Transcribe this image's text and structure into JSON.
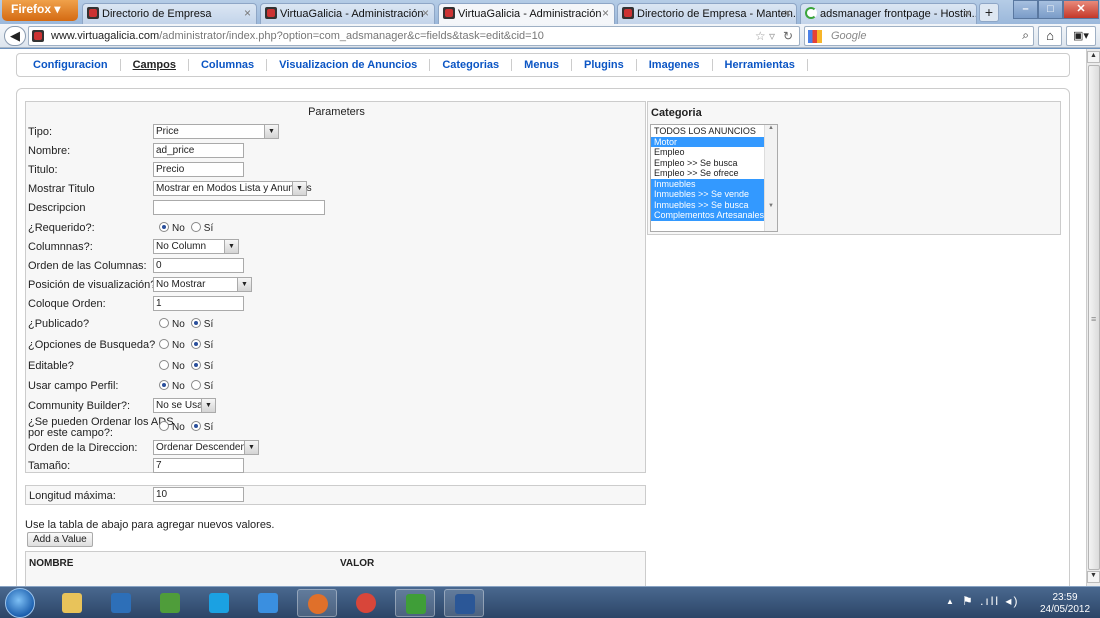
{
  "browser": {
    "app_button": "Firefox",
    "tabs": [
      {
        "title": "Directorio de Empresa"
      },
      {
        "title": "VirtuaGalicia - Administración"
      },
      {
        "title": "VirtuaGalicia - Administración"
      },
      {
        "title": "Directorio de Empresa - Manten..."
      },
      {
        "title": "adsmanager frontpage - Hostin..."
      }
    ],
    "url_domain": "www.virtuagalicia.com",
    "url_path": "/administrator/index.php?option=com_adsmanager&c=fields&task=edit&cid=10",
    "search_placeholder": "Google",
    "tab_close_glyph": "×",
    "new_tab_glyph": "+",
    "window_min": "–",
    "window_max": "□",
    "window_close": "✕"
  },
  "submenu": [
    {
      "label": "Configuracion"
    },
    {
      "label": "Campos"
    },
    {
      "label": "Columnas"
    },
    {
      "label": "Visualizacion de Anuncios"
    },
    {
      "label": "Categorias"
    },
    {
      "label": "Menus"
    },
    {
      "label": "Plugins"
    },
    {
      "label": "Imagenes"
    },
    {
      "label": "Herramientas"
    }
  ],
  "params": {
    "title": "Parameters",
    "radio_no": "No",
    "radio_si": "Sí",
    "tipo": {
      "label": "Tipo:",
      "value": "Price"
    },
    "nombre": {
      "label": "Nombre:",
      "value": "ad_price"
    },
    "titulo": {
      "label": "Titulo:",
      "value": "Precio"
    },
    "mostrar_titulo": {
      "label": "Mostrar Titulo",
      "value": "Mostrar en Modos Lista y Anuncios"
    },
    "descripcion": {
      "label": "Descripcion",
      "value": ""
    },
    "requerido": {
      "label": "¿Requerido?:",
      "selected": "No"
    },
    "columnas": {
      "label": "Columnnas?:",
      "value": "No Column"
    },
    "orden_columnas": {
      "label": "Orden de las Columnas:",
      "value": "0"
    },
    "posicion": {
      "label": "Posición de visualización?:",
      "value": "No Mostrar"
    },
    "coloque_orden": {
      "label": "Coloque Orden:",
      "value": "1"
    },
    "publicado": {
      "label": "¿Publicado?",
      "selected": "Sí"
    },
    "opciones_busqueda": {
      "label": "¿Opciones de Busqueda?",
      "selected": "Sí"
    },
    "editable": {
      "label": "Editable?",
      "selected": "Sí"
    },
    "usar_perfil": {
      "label": "Usar campo Perfil:",
      "selected": "No"
    },
    "community_builder": {
      "label": "Community Builder?:",
      "value": "No se Usa"
    },
    "ordenar_ads_line1": "¿Se pueden Ordenar los ADS",
    "ordenar_ads_line2": "por este campo?:",
    "ordenar_ads_selected": "Sí",
    "orden_direccion": {
      "label": "Orden de la Direccion:",
      "value": "Ordenar Descendente"
    },
    "tamano": {
      "label": "Tamaño:",
      "value": "7"
    }
  },
  "longitud": {
    "label": "Longitud máxima:",
    "value": "10"
  },
  "categoria": {
    "title": "Categoria",
    "items": [
      {
        "label": "TODOS LOS ANUNCIOS",
        "selected": false
      },
      {
        "label": "Motor",
        "selected": true
      },
      {
        "label": "Empleo",
        "selected": false
      },
      {
        "label": "Empleo >> Se busca",
        "selected": false
      },
      {
        "label": "Empleo >> Se ofrece",
        "selected": false
      },
      {
        "label": "Inmuebles",
        "selected": true
      },
      {
        "label": "Inmuebles >> Se vende",
        "selected": true
      },
      {
        "label": "Inmuebles >> Se busca",
        "selected": true
      },
      {
        "label": "Complementos Artesanales",
        "selected": true
      }
    ]
  },
  "values_section": {
    "hint": "Use la tabla de abajo para agregar nuevos valores.",
    "add_button": "Add a Value",
    "col_nombre": "NOMBRE",
    "col_valor": "VALOR"
  },
  "taskbar": {
    "apps": [
      {
        "name": "explorer-icon",
        "color": "#e8c35a"
      },
      {
        "name": "media-center-icon",
        "color": "#2d6fb8"
      },
      {
        "name": "people-icon",
        "color": "#4f9d3a"
      },
      {
        "name": "skype-icon",
        "color": "#1ba1e2"
      },
      {
        "name": "internet-explorer-icon",
        "color": "#3a8fe0"
      },
      {
        "name": "firefox-icon",
        "color": "#e0702a"
      },
      {
        "name": "chrome-icon",
        "color": "#d8463a"
      },
      {
        "name": "utorrent-icon",
        "color": "#3f9e38"
      },
      {
        "name": "word-icon",
        "color": "#2b5797"
      }
    ],
    "time": "23:59",
    "date": "24/05/2012"
  },
  "colors": {
    "link_blue": "#0b55c4",
    "list_selection": "#3399ff",
    "taskbar": "#2c4567"
  }
}
